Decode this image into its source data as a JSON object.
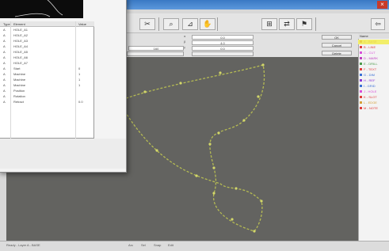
{
  "toolbar": {
    "buttons": [
      {
        "name": "paste-button",
        "glyph": "✂"
      },
      {
        "name": "zoom-button",
        "glyph": "⌕"
      },
      {
        "name": "measure-button",
        "glyph": "⊿"
      },
      {
        "name": "hand-button",
        "glyph": "✋"
      },
      {
        "name": "grid-button",
        "glyph": "⊞"
      },
      {
        "name": "mirror-button",
        "glyph": "⇄"
      },
      {
        "name": "flag-button",
        "glyph": "⚑"
      }
    ],
    "exit_glyph": "⇦"
  },
  "params": {
    "box1": "0.0",
    "box2": "4.0",
    "box3": "160",
    "box4": "0.0",
    "btn_ok": "OK",
    "btn_cancel": "Cancel",
    "btn_delete": "Delete"
  },
  "layers": {
    "header": "Name",
    "items": [
      {
        "label": "A - BASE",
        "color": "#e8d24a",
        "selected": true
      },
      {
        "label": "B - LINE",
        "color": "#e03c3c"
      },
      {
        "label": "C - CUT",
        "color": "#d94fd9"
      },
      {
        "label": "D - MARK",
        "color": "#c040c0"
      },
      {
        "label": "E - DRILL",
        "color": "#4c9b4c"
      },
      {
        "label": "F - TEXT",
        "color": "#e03c3c"
      },
      {
        "label": "G - DIM",
        "color": "#3a6fd6"
      },
      {
        "label": "H - REF",
        "color": "#8a3ad6"
      },
      {
        "label": "I - GRID",
        "color": "#3a6fd6"
      },
      {
        "label": "J - HOLE",
        "color": "#d94fd9"
      },
      {
        "label": "K - SLOT",
        "color": "#e03c3c"
      },
      {
        "label": "L - EDGE",
        "color": "#d6a03a"
      },
      {
        "label": "M - NOTE",
        "color": "#e03c3c"
      }
    ]
  },
  "dialog": {
    "columns": [
      "Type",
      "Element",
      "Value"
    ],
    "rows": [
      [
        "A",
        "HOLE_A1",
        ""
      ],
      [
        "A",
        "HOLE_A2",
        ""
      ],
      [
        "A",
        "HOLE_A3",
        ""
      ],
      [
        "A",
        "HOLE_A4",
        ""
      ],
      [
        "A",
        "HOLE_A5",
        ""
      ],
      [
        "A",
        "HOLE_A6",
        ""
      ],
      [
        "A",
        "HOLE_A7",
        ""
      ],
      [
        "A",
        "Start",
        "0"
      ],
      [
        "A",
        "Machine",
        "1"
      ],
      [
        "A",
        "Machine",
        "1"
      ],
      [
        "A",
        "Machine",
        "1"
      ],
      [
        "A",
        "Position",
        ""
      ],
      [
        "A",
        "Rotation",
        ""
      ],
      [
        "A",
        "Retract",
        "0.0"
      ]
    ]
  },
  "status": {
    "left": "Ready - Layer A - BASE",
    "mid1": "Arc",
    "mid2": "Sel",
    "mid3": "Snap",
    "mid4": "Edit"
  }
}
